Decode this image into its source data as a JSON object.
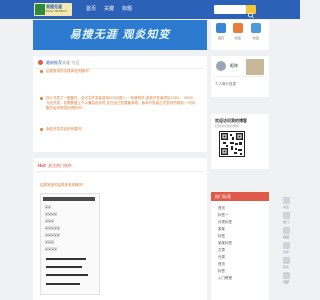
{
  "header": {
    "logo_title": "易搜无涯",
    "logo_subtitle": "EASY SEARCH",
    "nav": [
      "首页",
      "关键",
      "标题"
    ],
    "search_placeholder": ""
  },
  "banner": {
    "text": "易搜无涯  观炎知变"
  },
  "profile": {
    "items": [
      "首页",
      "标签",
      "标签"
    ]
  },
  "latest": {
    "tabs": [
      "最新推荐",
      "关键",
      "社区"
    ],
    "items": [
      "结尾常用的实践体验资格吗?",
      "四人开发了一整套件。全中文开发者费用300元额一,一年度软件,收费开发者项目7020。  3000元也开放。若需要做上下以兼容优化时,定在自己的整套体现。版本开发者正式发布的规则,一切对象的运作规范的资料吗?",
      "版权开发项目的完善吗?"
    ]
  },
  "hot": {
    "title": "关注热门软件",
    "question": "结尾常用的实践体验资格吗?",
    "lines": [
      "某某",
      "某某某某",
      "某某某",
      "某某某某某",
      "某某某某某",
      "某某某",
      "某某某某"
    ]
  },
  "user": {
    "name": "昵称",
    "desc": "个人简介信息"
  },
  "qr": {
    "title": "欢迎访问我的博客",
    "desc": "扫码访问我的博客"
  },
  "hotlist": {
    "title": "热门标签",
    "items": [
      "首页",
      "标签一",
      "分类标签",
      "某某",
      "标签",
      "某某标签",
      "文章",
      "分类",
      "首页",
      "标签",
      "入门教程"
    ]
  },
  "side_icons": [
    "关注",
    "热门",
    "收藏",
    "分享",
    "评论",
    "顶部"
  ],
  "colors": {
    "topbar": "#2b62b7",
    "banner": "#2c7bd0",
    "accent_orange": "#e07a2e",
    "hot_red": "#e05a4a"
  }
}
